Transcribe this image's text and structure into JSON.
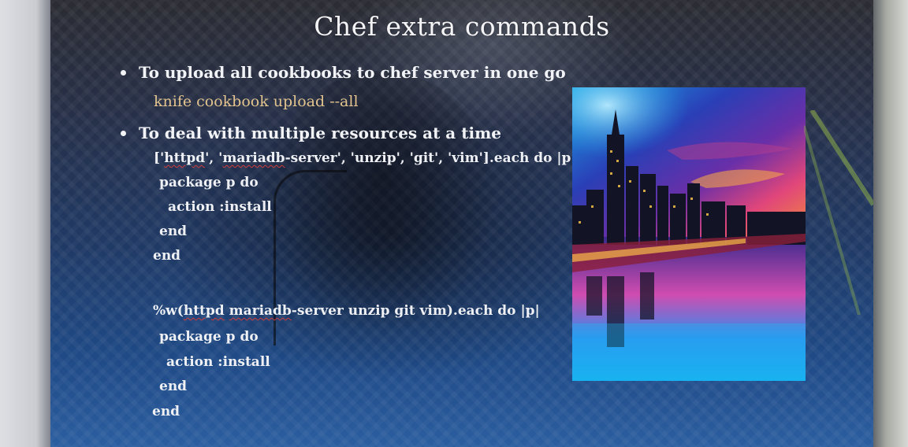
{
  "slide": {
    "title": "Chef extra commands",
    "bullets": [
      {
        "text": "To upload all cookbooks to chef server in one go"
      },
      {
        "text": "To deal with multiple resources at a time"
      }
    ],
    "upload_command": "knife cookbook upload --all",
    "code_block_1": {
      "line1_prefix": "['",
      "line1_httpd": "httpd",
      "line1_mid": "', '",
      "line1_mariadb": "mariadb",
      "line1_rest": "-server', 'unzip', 'git', 'vim'].each do |p|",
      "line2": "package p do",
      "line3": "action :install",
      "line4": "end",
      "line5": "end"
    },
    "code_block_2": {
      "line1_prefix": "%w(",
      "line1_httpd": "httpd",
      "line1_space": " ",
      "line1_mariadb": "mariadb",
      "line1_rest": "-server unzip git vim).each do |p|",
      "line2": "package p do",
      "line3": "action :install",
      "line4": "end",
      "line5": "end"
    },
    "image": {
      "subject": "city-skyline-night-river-image"
    }
  },
  "colors": {
    "title": "#f4f4f6",
    "bullet_text": "#f2f3f6",
    "command": "#e3c48f",
    "code": "#eef0f4",
    "spell_underline": "#d23c3c"
  }
}
